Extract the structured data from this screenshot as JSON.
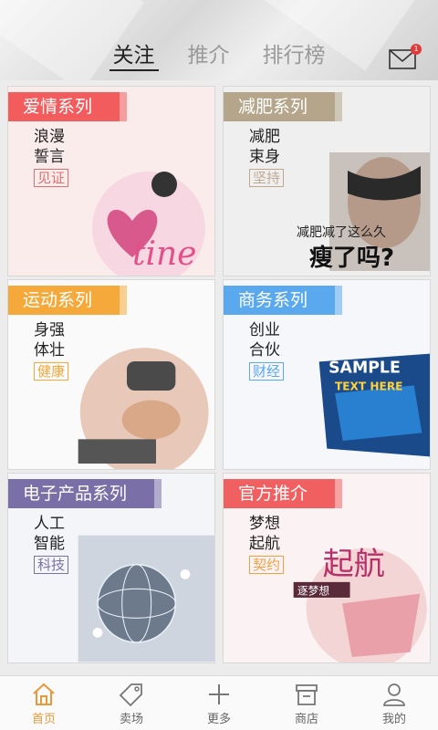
{
  "header": {
    "tabs": [
      {
        "label": "关注",
        "active": true
      },
      {
        "label": "推介",
        "active": false
      },
      {
        "label": "排行榜",
        "active": false
      }
    ],
    "mail_badge": "1"
  },
  "cards": [
    {
      "title": "爱情系列",
      "line1": "浪漫",
      "line2": "誓言",
      "tag": "见证",
      "color": "#f25c5c",
      "tag_color": "#e07070",
      "art_text": "tine"
    },
    {
      "title": "减肥系列",
      "line1": "减肥",
      "line2": "束身",
      "tag": "坚持",
      "color": "#b5a58a",
      "tag_color": "#c0a890",
      "art_text_1": "减肥减了这么久",
      "art_text_2": "瘦了吗?"
    },
    {
      "title": "运动系列",
      "line1": "身强",
      "line2": "体壮",
      "tag": "健康",
      "color": "#f5a93a",
      "tag_color": "#f5a93a"
    },
    {
      "title": "商务系列",
      "line1": "创业",
      "line2": "合伙",
      "tag": "财经",
      "color": "#5aa8ee",
      "tag_color": "#5aa8ee",
      "art_text_1": "SAMPLE",
      "art_text_2": "TEXT HERE"
    },
    {
      "title": "电子产品系列",
      "line1": "人工",
      "line2": "智能",
      "tag": "科技",
      "color": "#7a6fa6",
      "tag_color": "#7a6fa6"
    },
    {
      "title": "官方推介",
      "line1": "梦想",
      "line2": "起航",
      "tag": "契约",
      "color": "#f06060",
      "tag_color": "#f0a040",
      "art_text_1": "起航",
      "art_text_2": "逐梦想"
    }
  ],
  "tabbar": [
    {
      "label": "首页",
      "icon": "home-icon",
      "active": true
    },
    {
      "label": "卖场",
      "icon": "tag-icon",
      "active": false
    },
    {
      "label": "更多",
      "icon": "plus-icon",
      "active": false
    },
    {
      "label": "商店",
      "icon": "store-icon",
      "active": false
    },
    {
      "label": "我的",
      "icon": "user-icon",
      "active": false
    }
  ]
}
